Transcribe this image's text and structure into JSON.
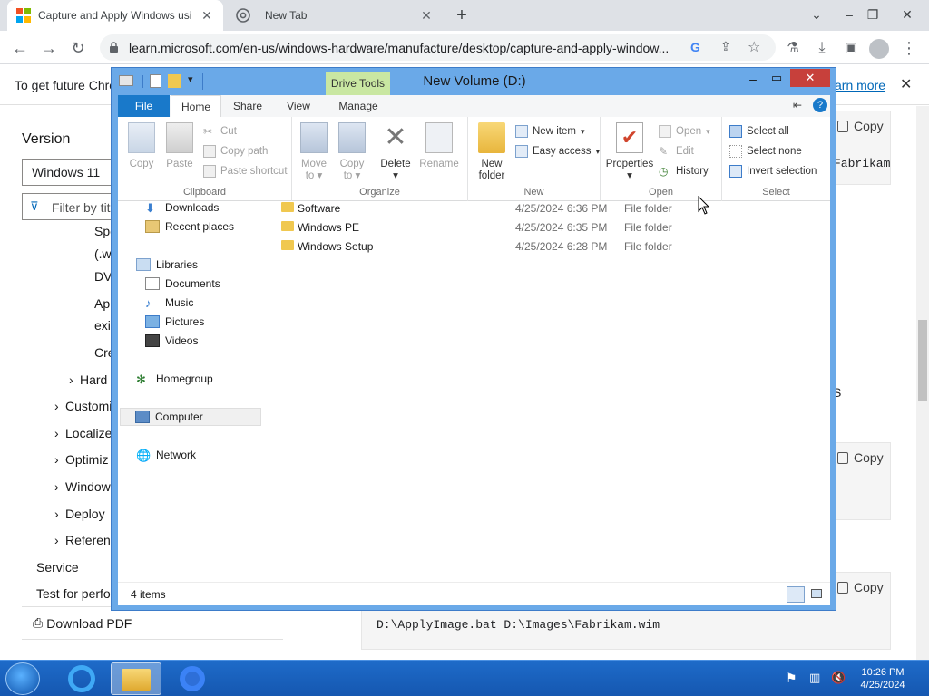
{
  "browser": {
    "tabs": [
      {
        "title": "Capture and Apply Windows usi",
        "active": true
      },
      {
        "title": "New Tab",
        "active": false
      }
    ],
    "new_tab": "+",
    "url": "learn.microsoft.com/en-us/windows-hardware/manufacture/desktop/capture-and-apply-window..."
  },
  "page": {
    "infobar_text": "To get future Chro",
    "learn_more": "arn more",
    "version_label": "Version",
    "version_value": "Windows 11",
    "filter_placeholder": "Filter by tit",
    "toc_fragments": [
      "Spe",
      "(.w",
      "DV",
      "Ap",
      "exi",
      "Cre"
    ],
    "toc_items": [
      "Hard",
      "Customi",
      "Localize",
      "Optimiz",
      "Window",
      "Deploy",
      "Referen"
    ],
    "service": "Service",
    "test_perf": "Test for perfo",
    "download_pdf": "Download PDF",
    "copy_label": "Copy",
    "code_line_top": "Fabrikam",
    "code_line_bottom": "D:\\ApplyImage.bat D:\\Images\\Fabrikam.wim",
    "stray_text": "S"
  },
  "explorer": {
    "title": "New Volume (D:)",
    "context_tab": "Drive Tools",
    "tabs": [
      "File",
      "Home",
      "Share",
      "View",
      "Manage"
    ],
    "groups": {
      "clipboard": {
        "label": "Clipboard",
        "copy": "Copy",
        "paste": "Paste",
        "cut": "Cut",
        "copy_path": "Copy path",
        "paste_shortcut": "Paste shortcut"
      },
      "organize": {
        "label": "Organize",
        "move_to": "Move",
        "move_to2": "to",
        "copy_to": "Copy",
        "copy_to2": "to",
        "delete": "Delete",
        "rename": "Rename"
      },
      "new": {
        "label": "New",
        "new_folder": "New",
        "new_folder2": "folder",
        "new_item": "New item",
        "easy_access": "Easy access"
      },
      "open": {
        "label": "Open",
        "properties": "Properties",
        "open": "Open",
        "edit": "Edit",
        "history": "History"
      },
      "select": {
        "label": "Select",
        "select_all": "Select all",
        "select_none": "Select none",
        "invert": "Invert selection"
      }
    },
    "nav": [
      {
        "label": "Downloads"
      },
      {
        "label": "Recent places"
      },
      {
        "label": "Libraries"
      },
      {
        "label": "Documents"
      },
      {
        "label": "Music"
      },
      {
        "label": "Pictures"
      },
      {
        "label": "Videos"
      },
      {
        "label": "Homegroup"
      },
      {
        "label": "Computer"
      },
      {
        "label": "Network"
      }
    ],
    "files": [
      {
        "name": "Software",
        "date": "4/25/2024 6:36 PM",
        "type": "File folder"
      },
      {
        "name": "Windows PE",
        "date": "4/25/2024 6:35 PM",
        "type": "File folder"
      },
      {
        "name": "Windows Setup",
        "date": "4/25/2024 6:28 PM",
        "type": "File folder"
      }
    ],
    "status": "4 items"
  },
  "taskbar": {
    "time": "10:26 PM",
    "date": "4/25/2024"
  }
}
